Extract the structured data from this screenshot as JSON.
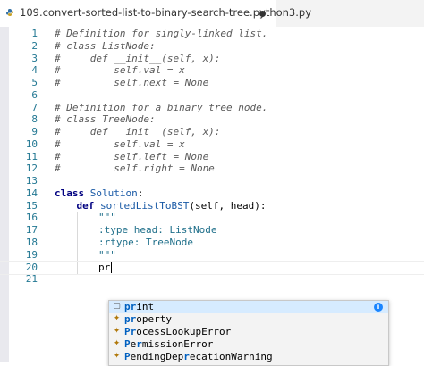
{
  "tab": {
    "title": "109.convert-sorted-list-to-binary-search-tree.python3.py",
    "icon": "python-file-icon",
    "modified_dot": "unsaved-changes-dot"
  },
  "lines": [
    {
      "n": "1",
      "text": "# Definition for singly-linked list."
    },
    {
      "n": "2",
      "text": "# class ListNode:"
    },
    {
      "n": "3",
      "text": "#     def __init__(self, x):"
    },
    {
      "n": "4",
      "text": "#         self.val = x"
    },
    {
      "n": "5",
      "text": "#         self.next = None"
    },
    {
      "n": "6",
      "text": ""
    },
    {
      "n": "7",
      "text": "# Definition for a binary tree node."
    },
    {
      "n": "8",
      "text": "# class TreeNode:"
    },
    {
      "n": "9",
      "text": "#     def __init__(self, x):"
    },
    {
      "n": "10",
      "text": "#         self.val = x"
    },
    {
      "n": "11",
      "text": "#         self.left = None"
    },
    {
      "n": "12",
      "text": "#         self.right = None"
    },
    {
      "n": "13",
      "text": ""
    },
    {
      "n": "14",
      "kw": "class",
      "name": "Solution",
      "rest": ":"
    },
    {
      "n": "15",
      "kw": "def",
      "name": "sortedListToBST",
      "rest": "(self, head):"
    },
    {
      "n": "16",
      "text": "\"\"\""
    },
    {
      "n": "17",
      "text": ":type head: ListNode"
    },
    {
      "n": "18",
      "text": ":rtype: TreeNode"
    },
    {
      "n": "19",
      "text": "\"\"\""
    },
    {
      "n": "20",
      "text": "pr"
    },
    {
      "n": "21",
      "text": ""
    }
  ],
  "suggestions": [
    {
      "match": "pr",
      "rest": "int",
      "icon": "symbol-keyword-icon"
    },
    {
      "match": "pr",
      "rest": "operty",
      "icon": "symbol-class-icon"
    },
    {
      "match": "Pr",
      "rest": "ocessLookupError",
      "icon": "symbol-class-icon"
    },
    {
      "match": "P",
      "mid": "e",
      "match2": "r",
      "rest": "missionError",
      "icon": "symbol-class-icon"
    },
    {
      "match": "P",
      "mid": "endingDep",
      "match2": "r",
      "rest": "ecationWarning",
      "icon": "symbol-class-icon"
    }
  ],
  "suggest_info": "i",
  "colors": {
    "line_number": "#237893",
    "comment": "#5a5a5a",
    "keyword": "#000080",
    "class_name": "#1a5aa6",
    "selected_suggestion": "#d6ebff"
  }
}
